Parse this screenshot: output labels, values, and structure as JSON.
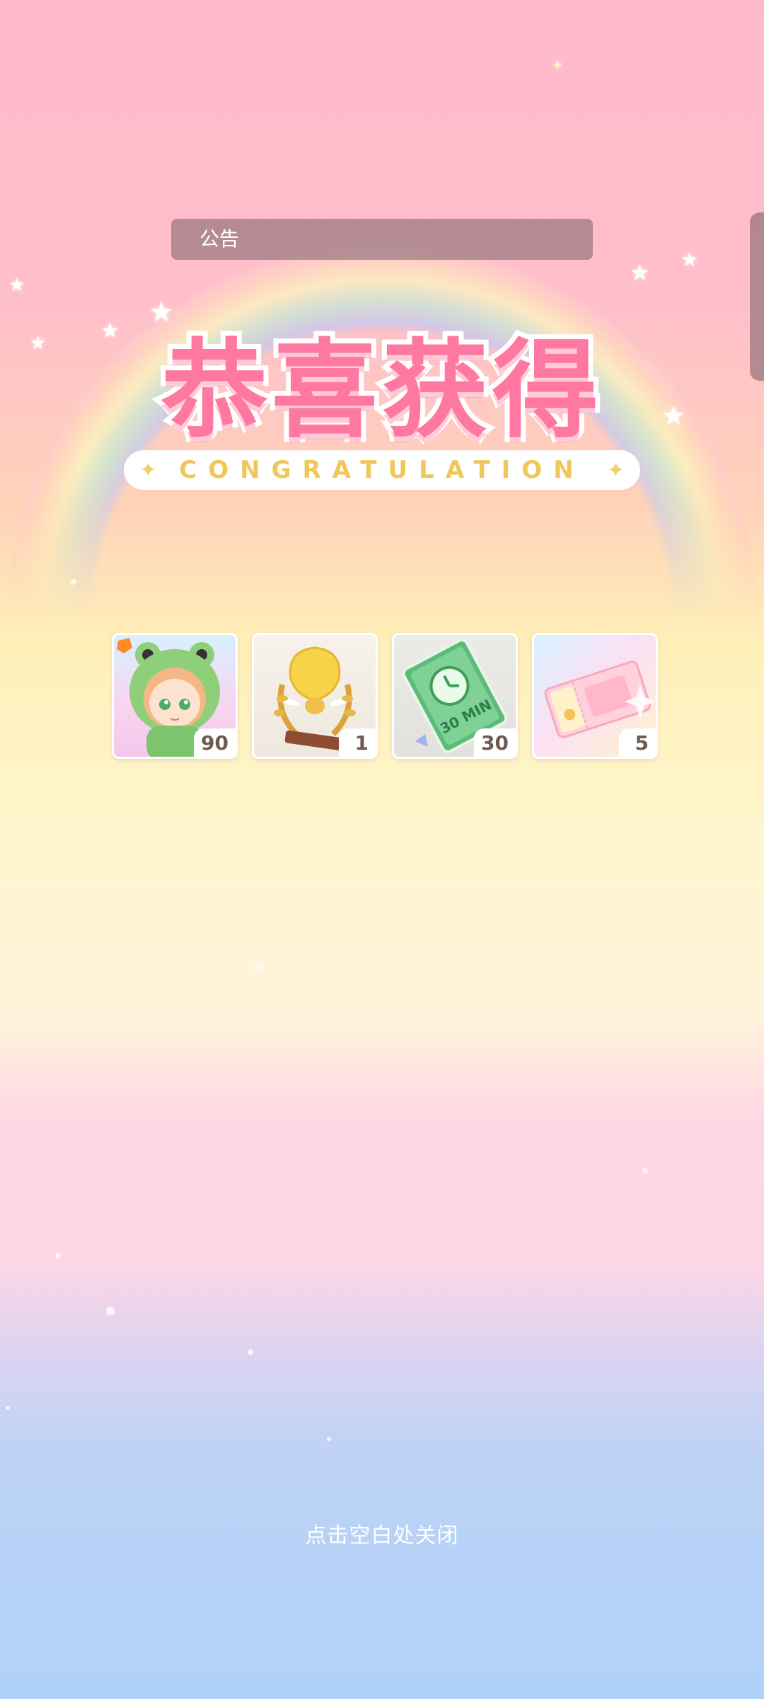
{
  "notice": {
    "label": "公告"
  },
  "header": {
    "title": "恭喜获得",
    "subtitle": "CONGRATULATION"
  },
  "rewards": [
    {
      "icon": "frog-hood-character-icon",
      "count": "90"
    },
    {
      "icon": "golden-trophy-icon",
      "count": "1"
    },
    {
      "icon": "30-min-speedup-ticket-icon",
      "count": "30",
      "ticket_text": "30 MIN"
    },
    {
      "icon": "pink-ticket-icon",
      "count": "5"
    }
  ],
  "footer": {
    "close_hint": "点击空白处关闭"
  },
  "colors": {
    "title_pink": "#ff78a2",
    "subtitle_gold": "#f0c75a",
    "count_text": "#6e5b50"
  }
}
